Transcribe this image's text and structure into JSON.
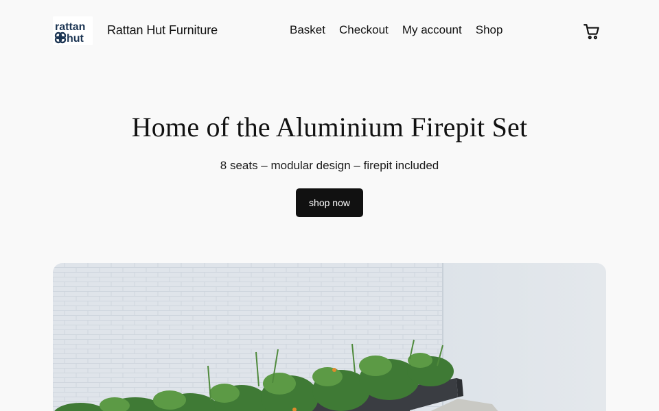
{
  "header": {
    "site_title": "Rattan Hut Furniture",
    "logo_line1": "rattan",
    "logo_line2": "hut",
    "nav": [
      {
        "label": "Basket"
      },
      {
        "label": "Checkout"
      },
      {
        "label": "My account"
      },
      {
        "label": "Shop"
      }
    ],
    "cart_icon": "shopping-cart-icon"
  },
  "hero": {
    "title": "Home of the Aluminium Firepit Set",
    "subtitle": "8 seats – modular design – firepit included",
    "button_label": "shop now"
  },
  "colors": {
    "background": "#f9f9f9",
    "text": "#111111",
    "button_bg": "#111111",
    "button_text": "#ffffff",
    "logo_navy": "#1c3553"
  }
}
